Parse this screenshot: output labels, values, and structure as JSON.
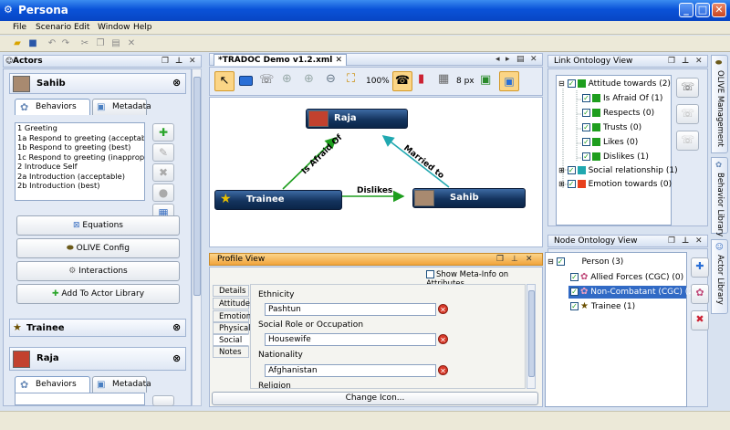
{
  "app": {
    "title": "Persona"
  },
  "menu": [
    "File",
    "Scenario",
    "Edit",
    "Window",
    "Help"
  ],
  "actors": {
    "title": "Actors",
    "sahib": {
      "name": "Sahib",
      "tab_behaviors": "Behaviors",
      "tab_metadata": "Metadata",
      "behaviors": [
        "1 Greeting",
        "1a Respond to greeting (acceptable",
        "1b Respond to greeting (best)",
        "1c Respond to greeting (inappropria",
        "2 Introduce Self",
        "2a Introduction (acceptable)",
        "2b Introduction (best)"
      ],
      "buttons": {
        "equations": "Equations",
        "olive_config": "OLIVE Config",
        "interactions": "Interactions",
        "add_library": "Add To Actor Library"
      }
    },
    "trainee": {
      "name": "Trainee"
    },
    "raja": {
      "name": "Raja",
      "tab_behaviors": "Behaviors",
      "tab_metadata": "Metadata"
    }
  },
  "editor": {
    "tab": "*TRADOC Demo v1.2.xml",
    "zoom": "100%",
    "grid": "8 px",
    "nodes": {
      "raja": "Raja",
      "trainee": "Trainee",
      "sahib": "Sahib"
    },
    "edges": {
      "afraid": "Is Afraid Of",
      "married": "Married to",
      "dislikes": "Dislikes"
    }
  },
  "profile": {
    "title": "Profile View",
    "show_meta": "Show Meta-Info on Attributes",
    "tabs": [
      "Details",
      "Attitudes",
      "Emotions",
      "Physical",
      "Social",
      "Notes"
    ],
    "fields": [
      {
        "label": "Ethnicity",
        "value": "Pashtun"
      },
      {
        "label": "Social Role or Occupation",
        "value": "Housewife"
      },
      {
        "label": "Nationality",
        "value": "Afghanistan"
      },
      {
        "label": "Religion",
        "value": ""
      }
    ],
    "change_icon": "Change Icon..."
  },
  "link_ontology": {
    "title": "Link Ontology View",
    "items": [
      {
        "label": "Attitude towards (2)",
        "color": "#1e9e1e"
      },
      {
        "label": "Is Afraid Of (1)",
        "color": "#1e9e1e"
      },
      {
        "label": "Respects (0)",
        "color": "#1e9e1e"
      },
      {
        "label": "Trusts (0)",
        "color": "#1e9e1e"
      },
      {
        "label": "Likes (0)",
        "color": "#1e9e1e"
      },
      {
        "label": "Dislikes (1)",
        "color": "#1e9e1e"
      },
      {
        "label": "Social relationship (1)",
        "color": "#20a8b0"
      },
      {
        "label": "Emotion towards (0)",
        "color": "#e8401c"
      }
    ]
  },
  "node_ontology": {
    "title": "Node Ontology View",
    "items": [
      {
        "label": "Person (3)"
      },
      {
        "label": "Allied Forces (CGC) (0)"
      },
      {
        "label": "Non-Combatant (CGC) (2)"
      },
      {
        "label": "Trainee (1)"
      }
    ]
  },
  "side_tabs": [
    "OLIVE Management",
    "Behavior Library",
    "Actor Library"
  ]
}
